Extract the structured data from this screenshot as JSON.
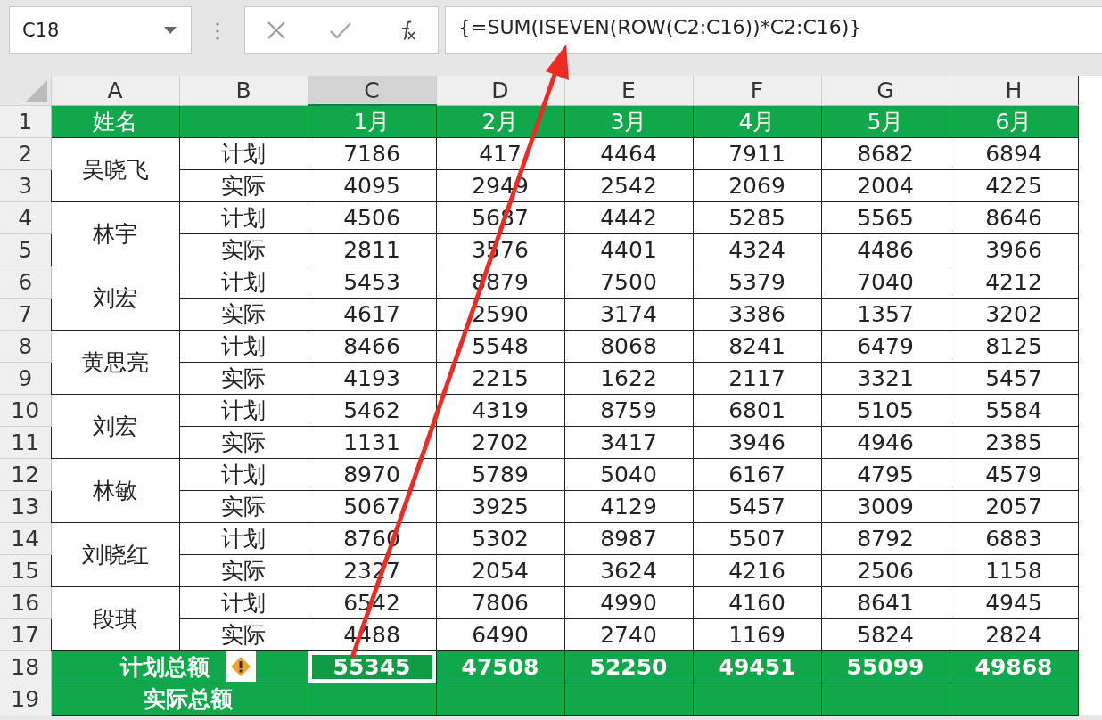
{
  "name_box": {
    "value": "C18"
  },
  "formula_bar": {
    "value": "{=SUM(ISEVEN(ROW(C2:C16))*C2:C16)}"
  },
  "columns": [
    {
      "label": "A",
      "selected": false
    },
    {
      "label": "B",
      "selected": false
    },
    {
      "label": "C",
      "selected": true
    },
    {
      "label": "D",
      "selected": false
    },
    {
      "label": "E",
      "selected": false
    },
    {
      "label": "F",
      "selected": false
    },
    {
      "label": "G",
      "selected": false
    },
    {
      "label": "H",
      "selected": false
    }
  ],
  "header_row": {
    "row": "1",
    "name": "姓名",
    "months": [
      "1月",
      "2月",
      "3月",
      "4月",
      "5月",
      "6月"
    ]
  },
  "people": [
    {
      "name": "吴晓飞",
      "rows": [
        {
          "row": "2",
          "label": "计划",
          "values": [
            "7186",
            "417",
            "4464",
            "7911",
            "8682",
            "6894"
          ]
        },
        {
          "row": "3",
          "label": "实际",
          "values": [
            "4095",
            "2949",
            "2542",
            "2069",
            "2004",
            "4225"
          ]
        }
      ]
    },
    {
      "name": "林宇",
      "rows": [
        {
          "row": "4",
          "label": "计划",
          "values": [
            "4506",
            "5687",
            "4442",
            "5285",
            "5565",
            "8646"
          ]
        },
        {
          "row": "5",
          "label": "实际",
          "values": [
            "2811",
            "3576",
            "4401",
            "4324",
            "4486",
            "3966"
          ]
        }
      ]
    },
    {
      "name": "刘宏",
      "rows": [
        {
          "row": "6",
          "label": "计划",
          "values": [
            "5453",
            "8879",
            "7500",
            "5379",
            "7040",
            "4212"
          ]
        },
        {
          "row": "7",
          "label": "实际",
          "values": [
            "4617",
            "2590",
            "3174",
            "3386",
            "1357",
            "3202"
          ]
        }
      ]
    },
    {
      "name": "黄思亮",
      "rows": [
        {
          "row": "8",
          "label": "计划",
          "values": [
            "8466",
            "5548",
            "8068",
            "8241",
            "6479",
            "8125"
          ]
        },
        {
          "row": "9",
          "label": "实际",
          "values": [
            "4193",
            "2215",
            "1622",
            "2117",
            "3321",
            "5457"
          ]
        }
      ]
    },
    {
      "name": "刘宏",
      "rows": [
        {
          "row": "10",
          "label": "计划",
          "values": [
            "5462",
            "4319",
            "8759",
            "6801",
            "5105",
            "5584"
          ]
        },
        {
          "row": "11",
          "label": "实际",
          "values": [
            "1131",
            "2702",
            "3417",
            "3946",
            "4946",
            "2385"
          ]
        }
      ]
    },
    {
      "name": "林敏",
      "rows": [
        {
          "row": "12",
          "label": "计划",
          "values": [
            "8970",
            "5789",
            "5040",
            "6167",
            "4795",
            "4579"
          ]
        },
        {
          "row": "13",
          "label": "实际",
          "values": [
            "5067",
            "3925",
            "4129",
            "5457",
            "3009",
            "2057"
          ]
        }
      ]
    },
    {
      "name": "刘晓红",
      "rows": [
        {
          "row": "14",
          "label": "计划",
          "values": [
            "8760",
            "5302",
            "8987",
            "5507",
            "8792",
            "6883"
          ]
        },
        {
          "row": "15",
          "label": "实际",
          "values": [
            "2327",
            "2054",
            "3624",
            "4216",
            "2506",
            "1158"
          ]
        }
      ]
    },
    {
      "name": "段琪",
      "rows": [
        {
          "row": "16",
          "label": "计划",
          "values": [
            "6542",
            "7806",
            "4990",
            "4160",
            "8641",
            "4945"
          ]
        },
        {
          "row": "17",
          "label": "实际",
          "values": [
            "4488",
            "6490",
            "2740",
            "1169",
            "5824",
            "2824"
          ]
        }
      ]
    }
  ],
  "totals": [
    {
      "row": "18",
      "label": "计划总额",
      "warning": true,
      "values": [
        {
          "text": "55345",
          "selected": true
        },
        {
          "text": "47508",
          "selected": false
        },
        {
          "text": "52250",
          "selected": false
        },
        {
          "text": "49451",
          "selected": false
        },
        {
          "text": "55099",
          "selected": false
        },
        {
          "text": "49868",
          "selected": false
        }
      ]
    },
    {
      "row": "19",
      "label": "实际总额"
    }
  ]
}
